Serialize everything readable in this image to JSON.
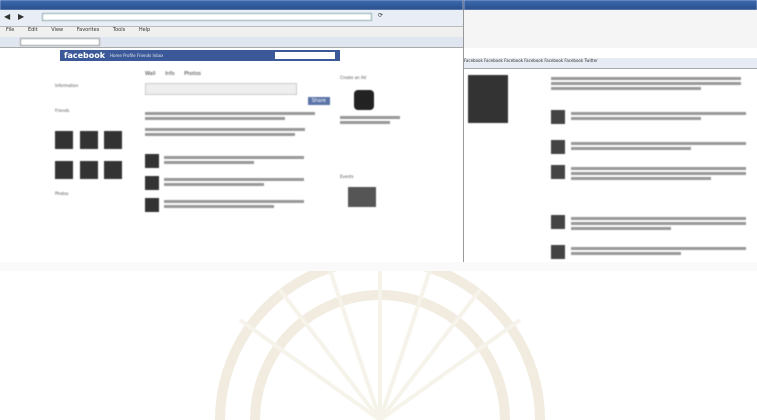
{
  "left_window": {
    "title_text": "",
    "address_text": "",
    "menu": [
      "File",
      "Edit",
      "View",
      "Favorites",
      "Tools",
      "Help"
    ],
    "tab_text": "",
    "facebook": {
      "logo": "facebook",
      "nav_items": [
        "Home",
        "Profile",
        "Friends",
        "Inbox"
      ],
      "profile_heading": "",
      "profile_name": "",
      "left_section_titles": [
        "Information",
        "Friends",
        "Photos"
      ],
      "mid_tabs": [
        "Wall",
        "Info",
        "Photos"
      ],
      "share_button": "Share",
      "right_section_titles": [
        "Create an Ad",
        "Events"
      ]
    }
  },
  "right_window": {
    "title_text": "",
    "bookmarks": [
      "Facebook",
      "Facebook",
      "Facebook",
      "Facebook",
      "Facebook",
      "Facebook",
      "Twitter"
    ]
  },
  "taskbar": {
    "left_text": ""
  }
}
